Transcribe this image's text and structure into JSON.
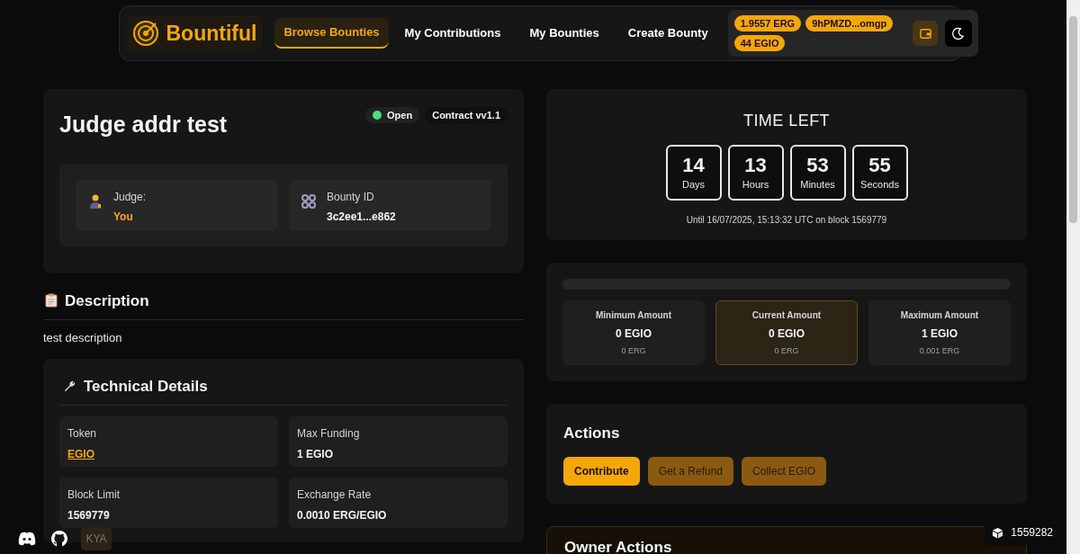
{
  "brand": {
    "name": "Bountiful"
  },
  "nav": [
    {
      "label": "Browse Bounties",
      "selected": true
    },
    {
      "label": "My Contributions",
      "selected": false
    },
    {
      "label": "My Bounties",
      "selected": false
    },
    {
      "label": "Create Bounty",
      "selected": false
    }
  ],
  "wallet": {
    "badges": [
      "1.9557 ERG",
      "9hPMZD...omgp",
      "44 EGIO"
    ]
  },
  "bounty": {
    "title": "Judge addr test",
    "status": {
      "label": "Open",
      "color": "#4ade80"
    },
    "contract": "Contract vv1.1",
    "info": [
      {
        "label": "Judge:",
        "value": "You",
        "kind": "judge"
      },
      {
        "label": "Bounty ID",
        "value": "3c2ee1...e862",
        "kind": "id"
      }
    ]
  },
  "description": {
    "heading": "Description",
    "text": "test description"
  },
  "technical": {
    "heading": "Technical Details",
    "items": [
      {
        "label": "Token",
        "value": "EGIO",
        "kind": "link"
      },
      {
        "label": "Max Funding",
        "value": "1 EGIO",
        "kind": "text"
      },
      {
        "label": "Block Limit",
        "value": "1569779",
        "kind": "text"
      },
      {
        "label": "Exchange Rate",
        "value": "0.0010 ERG/EGIO",
        "kind": "text"
      }
    ]
  },
  "countdown": {
    "title": "TIME LEFT",
    "units": [
      {
        "value": "14",
        "label": "Days"
      },
      {
        "value": "13",
        "label": "Hours"
      },
      {
        "value": "53",
        "label": "Minutes"
      },
      {
        "value": "55",
        "label": "Seconds"
      }
    ],
    "until": "Until 16/07/2025, 15:13:32 UTC on block 1569779"
  },
  "funding": {
    "level": 0,
    "amounts": [
      {
        "label": "Minimum Amount",
        "token": "0 EGIO",
        "erg": "0 ERG",
        "highlighted": false
      },
      {
        "label": "Current Amount",
        "token": "0 EGIO",
        "erg": "0 ERG",
        "highlighted": true
      },
      {
        "label": "Maximum Amount",
        "token": "1 EGIO",
        "erg": "0.001 ERG",
        "highlighted": false
      }
    ]
  },
  "actions": {
    "heading": "Actions",
    "buttons": [
      {
        "label": "Contribute",
        "disabled": false
      },
      {
        "label": "Get a Refund",
        "disabled": true
      },
      {
        "label": "Collect EGIO",
        "disabled": true
      }
    ]
  },
  "owner_actions": {
    "heading": "Owner Actions"
  },
  "footer": {
    "kya": "KYA",
    "block": "1559282"
  }
}
